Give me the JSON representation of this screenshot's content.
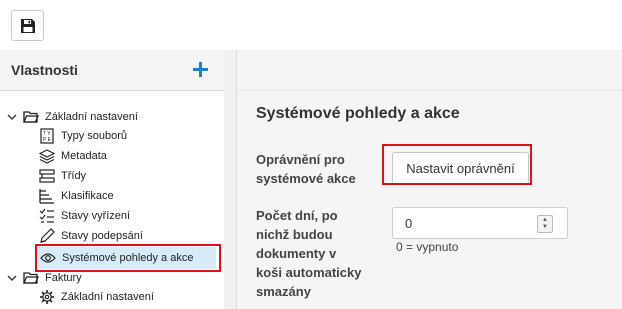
{
  "left_panel": {
    "title": "Vlastnosti",
    "tree": [
      {
        "label": "Základní nastavení",
        "icon": "folder-open-icon",
        "level": 0,
        "expanded": true
      },
      {
        "label": "Typy souborů",
        "icon": "file-types-icon",
        "level": 1
      },
      {
        "label": "Metadata",
        "icon": "layers-icon",
        "level": 1
      },
      {
        "label": "Třídy",
        "icon": "classes-icon",
        "level": 1
      },
      {
        "label": "Klasifikace",
        "icon": "classification-icon",
        "level": 1
      },
      {
        "label": "Stavy vyřízení",
        "icon": "checklist-icon",
        "level": 1
      },
      {
        "label": "Stavy podepsání",
        "icon": "pen-icon",
        "level": 1
      },
      {
        "label": "Systémové pohledy a akce",
        "icon": "eye-icon",
        "level": 1,
        "selected": true
      },
      {
        "label": "Faktury",
        "icon": "folder-open-icon",
        "level": 0,
        "expanded": true
      },
      {
        "label": "Základní nastavení",
        "icon": "gear-icon",
        "level": 1
      }
    ]
  },
  "main": {
    "section_title": "Systémové pohledy a akce",
    "permissions_label_line1": "Oprávnění pro",
    "permissions_label_line2": "systémové akce",
    "permissions_button": "Nastavit oprávnění",
    "days_label_lines": [
      "Počet dní, po",
      "nichž budou",
      "dokumenty v",
      "koši automaticky",
      "smazány"
    ],
    "days_value": "0",
    "days_hint": "0 = vypnuto"
  },
  "colors": {
    "accent": "#1e7fd0",
    "highlight_box": "#e0101a",
    "selected_bg": "#d6ecf8"
  }
}
